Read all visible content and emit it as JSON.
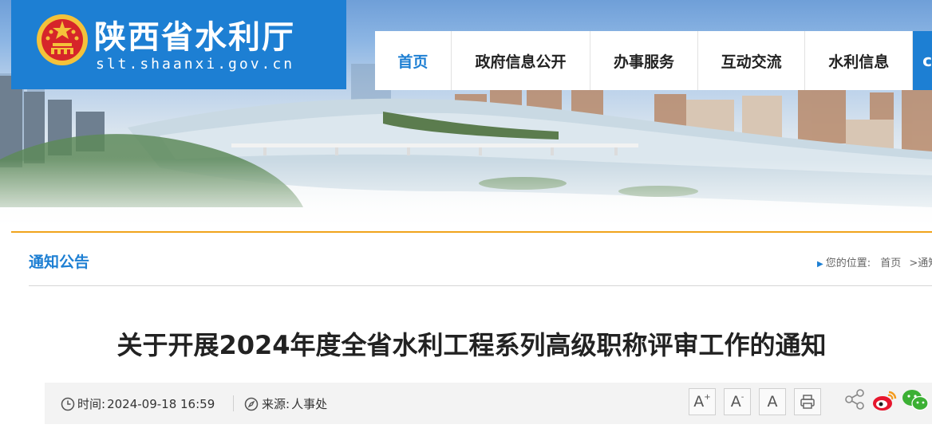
{
  "site": {
    "name": "陕西省水利厅",
    "domain": "slt.shaanxi.gov.cn"
  },
  "nav": {
    "items": [
      {
        "label": "首页",
        "active": true
      },
      {
        "label": "政府信息公开",
        "active": false
      },
      {
        "label": "办事服务",
        "active": false
      },
      {
        "label": "互动交流",
        "active": false
      },
      {
        "label": "水利信息",
        "active": false
      }
    ],
    "more_glyph": "c"
  },
  "section": {
    "title": "通知公告"
  },
  "breadcrumb": {
    "prefix": "您的位置:",
    "home": "首页",
    "separator": ">",
    "current": "通知公"
  },
  "article": {
    "title": "关于开展2024年度全省水利工程系列高级职称评审工作的通知",
    "time_label": "时间:",
    "time_value": "2024-09-18 16:59",
    "source_label": "来源:",
    "source_value": "人事处"
  },
  "tools": {
    "font_increase": "A",
    "font_increase_sign": "+",
    "font_decrease": "A",
    "font_decrease_sign": "-",
    "font_reset": "A"
  },
  "colors": {
    "brand_blue": "#1d7fd3",
    "accent_orange": "#f0a41c",
    "weibo_red": "#e6162d",
    "wechat_green": "#3cb034"
  },
  "icons": [
    "national-emblem-icon",
    "clock-icon",
    "compass-icon",
    "print-icon",
    "share-icon",
    "weibo-icon",
    "wechat-icon"
  ]
}
